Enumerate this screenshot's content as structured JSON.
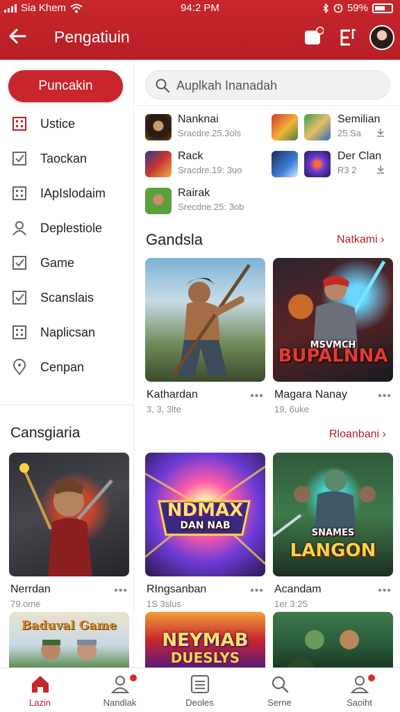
{
  "status_bar": {
    "carrier": "Sia Khem",
    "time": "94:2 PM",
    "battery": "59%"
  },
  "app_bar": {
    "title": "Pengatiuin"
  },
  "sidebar": {
    "primary_button": "Puncakin",
    "items": [
      {
        "label": "Ustice",
        "icon": "grid-icon"
      },
      {
        "label": "Taockan",
        "icon": "checkbox-icon"
      },
      {
        "label": "IApIslodaim",
        "icon": "grid-icon"
      },
      {
        "label": "Deplestiole",
        "icon": "person-icon"
      },
      {
        "label": "Game",
        "icon": "checkbox-icon"
      },
      {
        "label": "Scanslais",
        "icon": "checkbox-icon"
      },
      {
        "label": "Naplicsan",
        "icon": "grid-icon"
      },
      {
        "label": "Cenpan",
        "icon": "location-icon"
      }
    ],
    "section_title": "Cansgiaria",
    "card": {
      "name": "Nerrdan",
      "meta": "79.ome"
    },
    "card2": {
      "logo": "Baduval Game"
    }
  },
  "search": {
    "placeholder": "Auplkah Inanadah"
  },
  "apps": [
    {
      "name": "Nanknai",
      "meta": "Sracdre.25.3ols"
    },
    {
      "name": "Semilian",
      "meta": "25.Sa"
    },
    {
      "name": "Rack",
      "meta": "Sracdre.19: 3uo"
    },
    {
      "name": "Der Clan",
      "meta": "R3 2"
    },
    {
      "name": "Rairak",
      "meta": "Srecdne.25: 3ob"
    }
  ],
  "section1": {
    "title": "Gandsla",
    "link": "Natkami",
    "cards": [
      {
        "name": "Kathardan",
        "meta": "3, 3, 3lte",
        "logo": ""
      },
      {
        "name": "Magara Nanay",
        "meta": "19, 6uke",
        "logo_top": "MSVMCH",
        "logo": "BUPALNNA"
      }
    ]
  },
  "section2": {
    "link": "Rloanbani",
    "cards": [
      {
        "name": "RIngsanban",
        "meta": "1S 3slus",
        "logo": "NDMAX",
        "logo_sub": "DAN NAB"
      },
      {
        "name": "Acandam",
        "meta": "1er 3:25",
        "logo_top": "SNAMES",
        "logo": "LANGON"
      }
    ],
    "cards_bottom": [
      {
        "logo": "NEYMAB",
        "logo_sub": "DUESLYS"
      }
    ]
  },
  "bottom_nav": [
    {
      "label": "Lazin",
      "icon": "home-icon",
      "active": true
    },
    {
      "label": "Nandlak",
      "icon": "person-icon"
    },
    {
      "label": "Deoles",
      "icon": "grid-icon"
    },
    {
      "label": "Serne",
      "icon": "search-icon"
    },
    {
      "label": "Saoiht",
      "icon": "person-icon"
    }
  ],
  "colors": {
    "brand": "#c8262c",
    "link": "#b71f26"
  }
}
